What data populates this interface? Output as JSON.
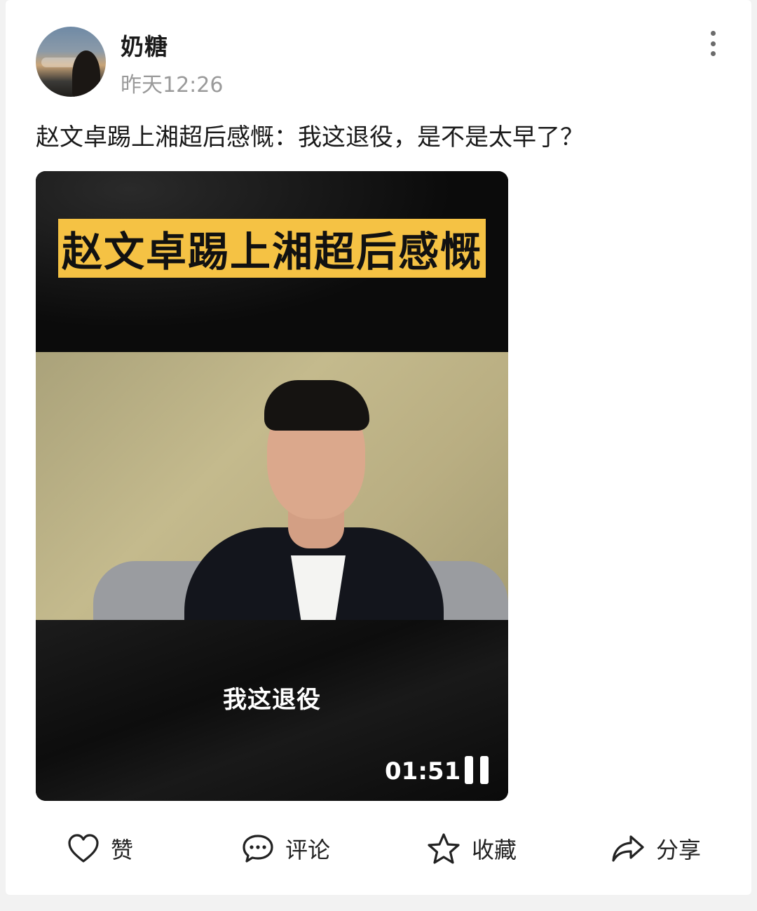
{
  "post": {
    "author": "奶糖",
    "time": "昨天12:26",
    "text": "赵文卓踢上湘超后感慨：我这退役，是不是太早了？"
  },
  "video": {
    "title_banner": "赵文卓踢上湘超后感慨",
    "subtitle": "我这退役",
    "duration": "01:51",
    "state": "playing"
  },
  "actions": {
    "like": "赞",
    "comment": "评论",
    "favorite": "收藏",
    "share": "分享"
  },
  "icons": {
    "more": "more-vertical-icon",
    "like": "heart-icon",
    "comment": "comment-bubble-icon",
    "favorite": "star-icon",
    "share": "share-arrow-icon",
    "pause": "pause-icon"
  },
  "colors": {
    "banner": "#f5c244",
    "text_primary": "#1a1a1a",
    "text_secondary": "#9a9a9a"
  }
}
